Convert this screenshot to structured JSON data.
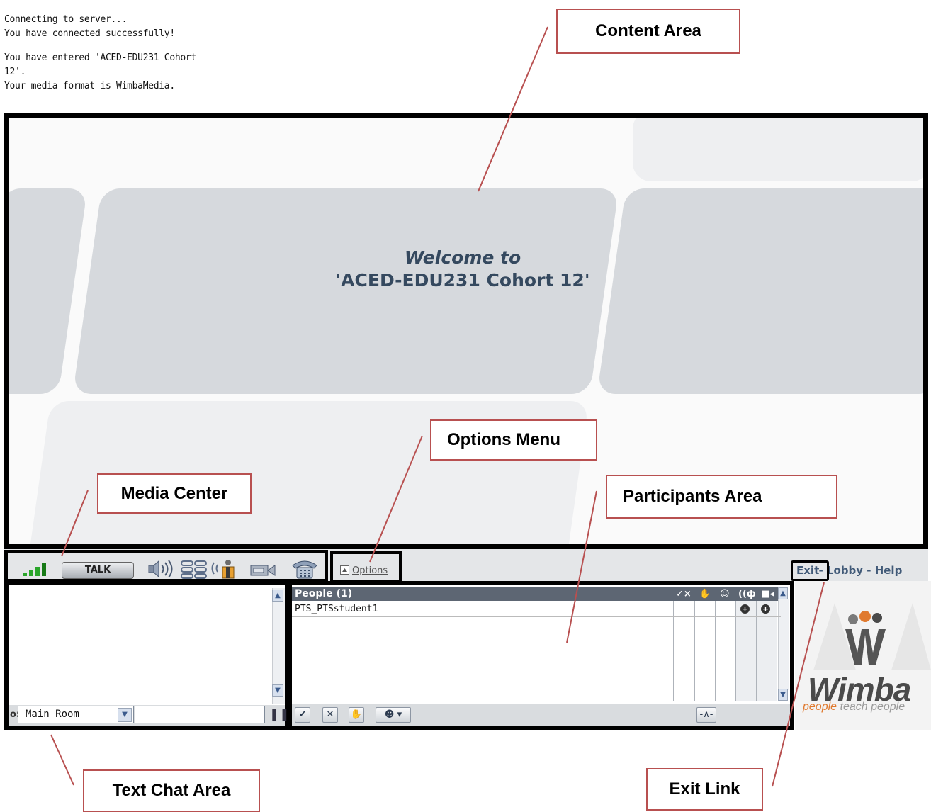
{
  "callouts": {
    "content_area": "Content Area",
    "options_menu": "Options Menu",
    "media_center": "Media Center",
    "participants_area": "Participants Area",
    "text_chat_area": "Text Chat Area",
    "exit_link": "Exit Link"
  },
  "content": {
    "welcome_line1": "Welcome to",
    "welcome_line2": "'ACED-EDU231 Cohort 12'"
  },
  "media_center": {
    "talk_label": "TALK",
    "icons": [
      "signal-bars-icon",
      "speaker-icon",
      "audio-grid-icon",
      "hand-mic-icon",
      "camera-icon",
      "telephone-icon"
    ]
  },
  "options": {
    "label": "Options"
  },
  "top_links": {
    "exit": "Exit",
    "sep1": " - ",
    "lobby": "Lobby",
    "sep2": " - ",
    "help": "Help"
  },
  "chat": {
    "messages": [
      "Connecting to server...",
      "You have connected successfully!",
      "",
      "You have entered 'ACED-EDU231 Cohort",
      "12'.",
      "Your media format is WimbaMedia."
    ],
    "to_label": "o:",
    "room": "Main Room"
  },
  "people": {
    "title": "People (1)",
    "participants": [
      {
        "name": "PTS_PTSstudent1"
      }
    ]
  },
  "logo": {
    "brand": "Wimba",
    "tag_orange": "people",
    "tag_rest": " teach people"
  },
  "colors": {
    "callout_border": "#b85050",
    "header_bg": "#5d6673",
    "welcome_text": "#35495f"
  }
}
